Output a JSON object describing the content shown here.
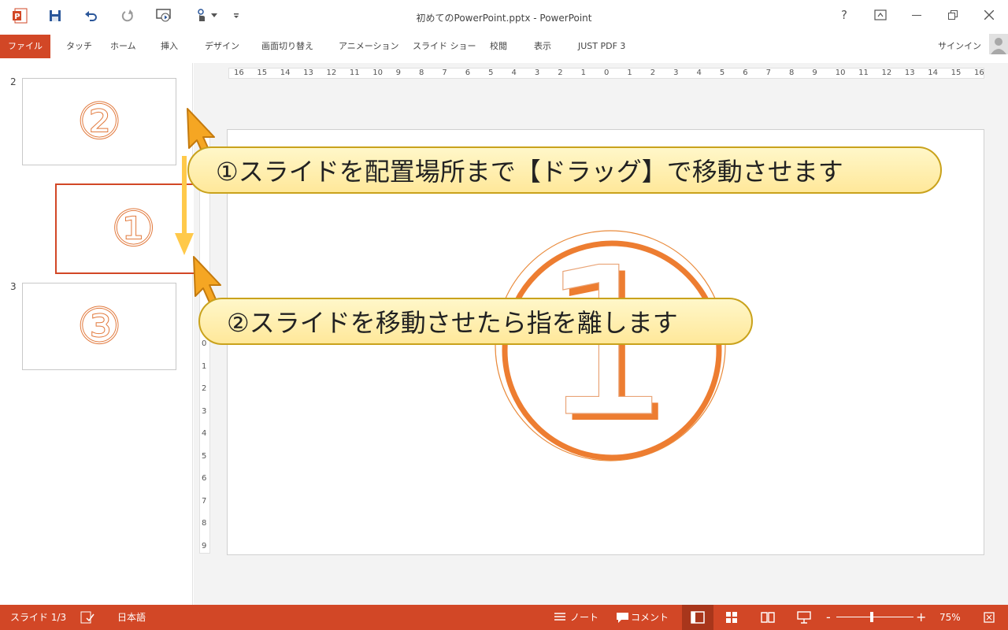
{
  "app": {
    "title": "初めてのPowerPoint.pptx - PowerPoint",
    "help": "?",
    "signin": "サインイン"
  },
  "ribbon": {
    "tabs": [
      {
        "label": "ファイル"
      },
      {
        "label": "タッチ"
      },
      {
        "label": "ホーム"
      },
      {
        "label": "挿入"
      },
      {
        "label": "デザイン"
      },
      {
        "label": "画面切り替え"
      },
      {
        "label": "アニメーション"
      },
      {
        "label": "スライド ショー"
      },
      {
        "label": "校閲"
      },
      {
        "label": "表示"
      },
      {
        "label": "JUST PDF 3"
      }
    ]
  },
  "thumbnails": [
    {
      "number": "2",
      "glyph": "②"
    },
    {
      "number": "",
      "glyph": "①"
    },
    {
      "number": "3",
      "glyph": "③"
    }
  ],
  "ruler": {
    "horizontal": [
      "16",
      "15",
      "14",
      "13",
      "12",
      "11",
      "10",
      "9",
      "8",
      "7",
      "6",
      "5",
      "4",
      "3",
      "2",
      "1",
      "0",
      "1",
      "2",
      "3",
      "4",
      "5",
      "6",
      "7",
      "8",
      "9",
      "10",
      "11",
      "12",
      "13",
      "14",
      "15",
      "16"
    ],
    "vertical": [
      "0",
      "1",
      "2",
      "3",
      "4",
      "5",
      "6",
      "7",
      "8",
      "9"
    ]
  },
  "slide": {
    "main_glyph": "1"
  },
  "callouts": {
    "step1": "①スライドを配置場所まで【ドラッグ】で移動させます",
    "step2": "②スライドを移動させたら指を離します"
  },
  "statusbar": {
    "slide_indicator": "スライド 1/3",
    "language": "日本語",
    "notes": "ノート",
    "comments": "コメント",
    "zoom_minus": "-",
    "zoom_plus": "+",
    "zoom": "75%",
    "zoom_fraction": 0.46
  },
  "colors": {
    "accent": "#d24726",
    "callout_fill": "#ffe89a",
    "arrow": "#ffc94a",
    "circle": "#e27b3f"
  }
}
